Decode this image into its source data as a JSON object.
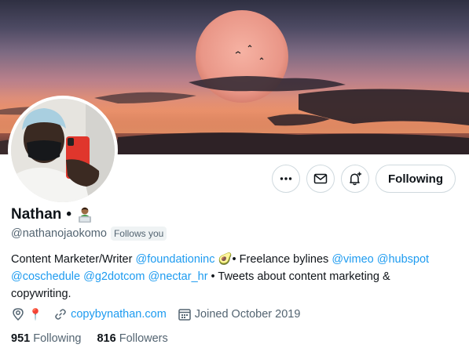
{
  "profile": {
    "display_name": "Nathan",
    "name_separator": "•",
    "handle": "@nathanojaokomo",
    "follows_you": "Follows you",
    "bio": {
      "t1": "Content Marketer/Writer ",
      "m1": "@foundationinc",
      "t2": " 🥑• Freelance bylines ",
      "m2": "@vimeo",
      "t3": " ",
      "m3": "@hubspot",
      "t4": " ",
      "m4": "@coschedule",
      "t5": " ",
      "m5": "@g2dotcom",
      "t6": " ",
      "m6": "@nectar_hr",
      "t7": " • Tweets about content marketing & copywriting."
    },
    "location_emoji": "📍",
    "website": "copybynathan.com",
    "joined": "Joined October 2019",
    "following_count": "951",
    "following_label": "Following",
    "followers_count": "816",
    "followers_label": "Followers"
  },
  "actions": {
    "more_icon": "more-horizontal-icon",
    "message_icon": "envelope-icon",
    "notify_icon": "bell-plus-icon",
    "follow_state_label": "Following"
  },
  "colors": {
    "link": "#1d9bf0",
    "secondary_text": "#536471",
    "border": "#cfd9de"
  }
}
